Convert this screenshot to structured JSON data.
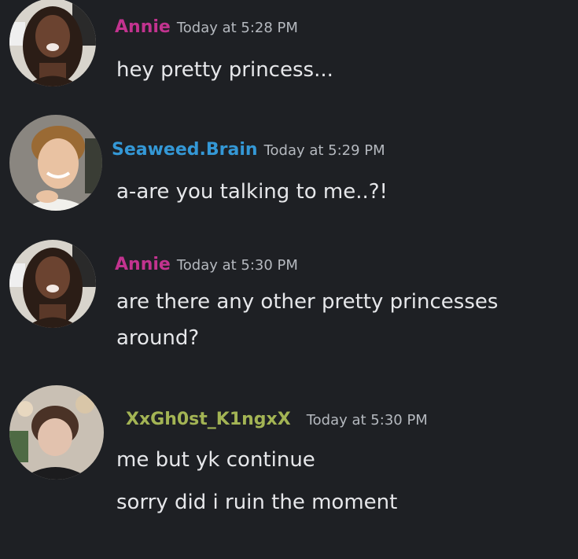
{
  "colors": {
    "background": "#1e2024",
    "annie": "#c2338f",
    "seaweed": "#3498d6",
    "xxghost": "#a3b454",
    "timestamp": "#b5b9bf",
    "text": "#e6e7ea"
  },
  "messages": [
    {
      "username": "Annie",
      "timestamp": "Today at 5:28 PM",
      "avatar": "annie-avatar",
      "lines": [
        "hey pretty princess..."
      ]
    },
    {
      "username": "Seaweed.Brain",
      "timestamp": "Today at 5:29 PM",
      "avatar": "seaweed-brain-avatar",
      "lines": [
        "a-are you talking to me..?!"
      ]
    },
    {
      "username": "Annie",
      "timestamp": "Today at 5:30 PM",
      "avatar": "annie-avatar",
      "lines": [
        "are there any other pretty princesses",
        "around?"
      ]
    },
    {
      "username": "XxGh0st_K1ngxX",
      "timestamp": "Today at 5:30 PM",
      "avatar": "xxghost-avatar",
      "lines": [
        "me but yk continue",
        "sorry did i ruin the moment"
      ]
    }
  ]
}
